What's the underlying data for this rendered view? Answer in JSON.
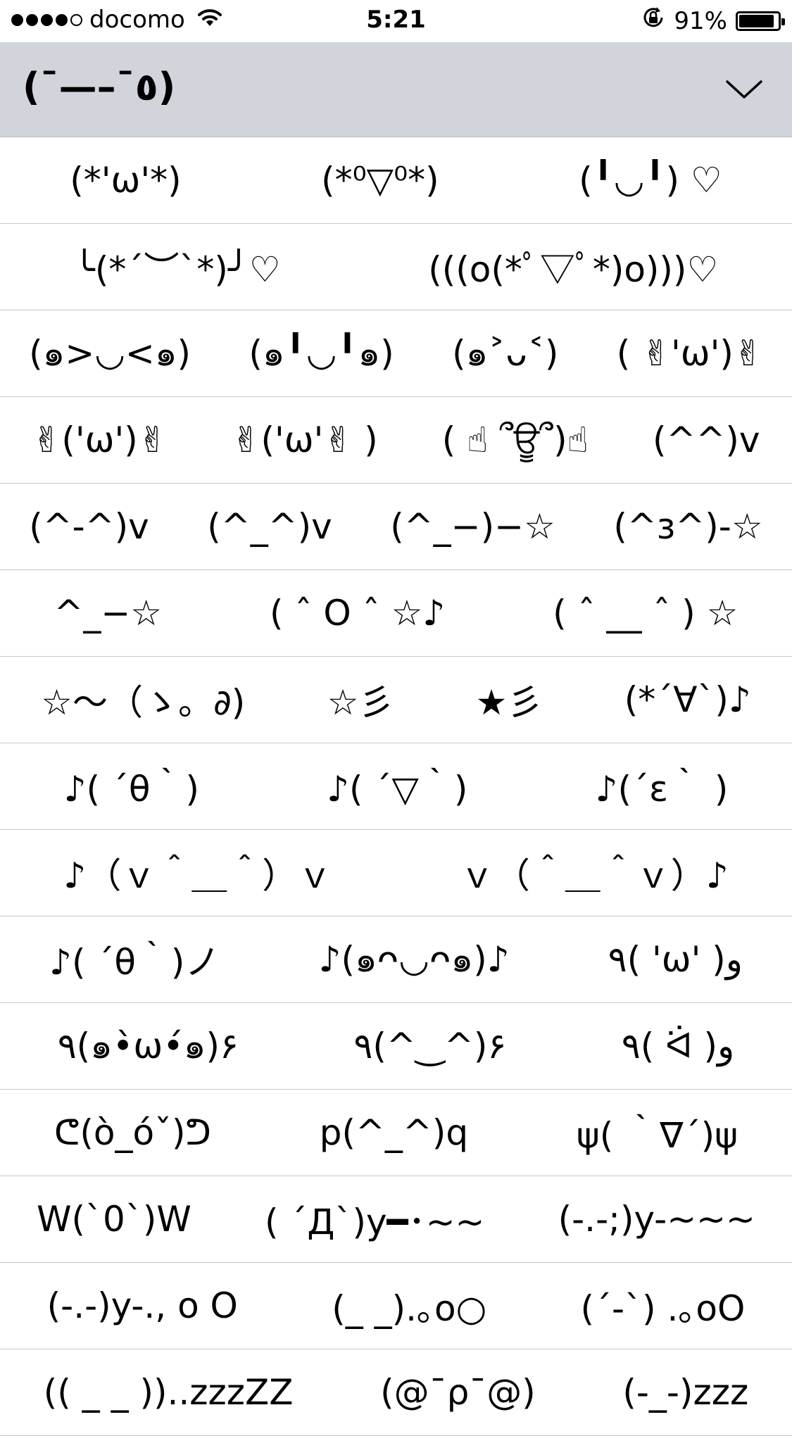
{
  "status_bar": {
    "carrier": "docomo",
    "time": "5:21",
    "battery_percent": "91%",
    "battery_level": 0.91,
    "icons": [
      "signal-dots",
      "wifi-icon",
      "rotation-lock-icon",
      "battery-icon"
    ]
  },
  "header": {
    "title": "(¯—–¯٥)",
    "chevron_icon": "chevron-down-icon"
  },
  "rows": [
    [
      "(*'ω'*)",
      "(*⁰▽⁰*)",
      "(╹◡╹) ♡"
    ],
    [
      "╰(*´︶`*)╯♡",
      "(((o(*ﾟ▽ﾟ*)o)))♡"
    ],
    [
      "(๑>◡<๑)",
      "(๑╹◡╹๑)",
      "(๑˃ᴗ˂)",
      "( ✌︎'ω')✌︎"
    ],
    [
      "✌︎('ω')✌︎",
      "✌︎('ω'✌︎ )",
      "( ☝︎ ՞ਊ՞)☝︎",
      "(^^)v"
    ],
    [
      "(^-^)v",
      "(^_^)v",
      "(^_−)−☆",
      "(^з^)-☆"
    ],
    [
      "^_−☆",
      "( ˆ O ˆ ☆♪",
      "( ˆ __ ˆ ) ☆"
    ],
    [
      "☆〜（ゝ。∂)",
      "☆彡",
      "★彡",
      "(*´∀`)♪"
    ],
    [
      "♪( ´θ｀)",
      "♪( ´▽｀)",
      "♪(´ε｀ )"
    ],
    [
      "♪（ｖ＾＿＾）ｖ",
      "ｖ（＾＿＾ｖ）♪"
    ],
    [
      "♪( ´θ｀)ノ",
      "♪(๑ᴖ◡ᴖ๑)♪",
      "٩( 'ω' )و"
    ],
    [
      "٩(๑•̀ω•́๑)۶",
      "٩(^‿^)۶",
      "٩( ᐛ )و"
    ],
    [
      "ᕦ(ò_óˇ)ᕤ",
      "p(^_^)q",
      "ψ( ｀∇´)ψ"
    ],
    [
      "W(`0`)W",
      "( ´Д`)y━･~~",
      "(-.-;)y-~~~"
    ],
    [
      "(-.-)y-., o O",
      "(_ _).｡o○",
      "(´-`) .｡oO"
    ],
    [
      "(( _ _ ))..zzzZZ",
      "(@¯ρ¯@)",
      "(-_-)zzz"
    ]
  ]
}
